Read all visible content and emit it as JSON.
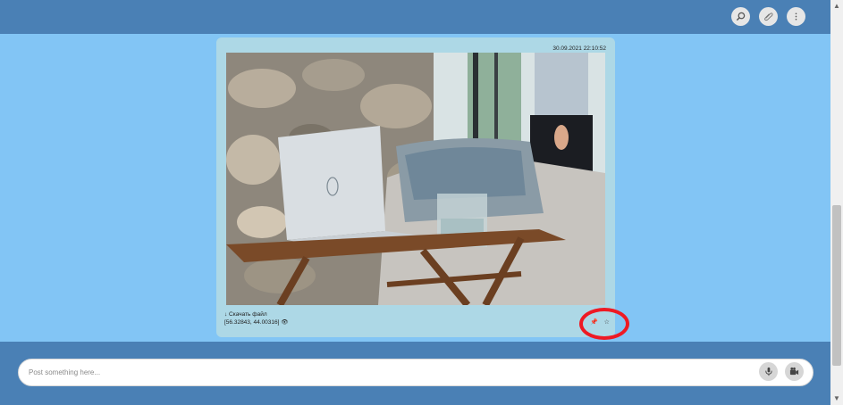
{
  "header": {
    "search_icon": "search-icon",
    "attach_icon": "paperclip-icon",
    "menu_icon": "more-vertical-icon"
  },
  "message": {
    "timestamp": "30.09.2021 22:10:52",
    "download_label": "↓ Скачать файл",
    "coordinates": "[56.32843, 44.00316]",
    "eye_glyph": "👁",
    "pin_icon": "pin-icon",
    "star_icon": "star-icon"
  },
  "composer": {
    "placeholder": "Post something here...",
    "mic_icon": "microphone-icon",
    "video_icon": "video-camera-icon"
  },
  "colors": {
    "topbar": "#4a80b5",
    "chat_bg": "#82c5f5",
    "message_bg": "#add8e6",
    "annotation": "#ee1a24"
  }
}
